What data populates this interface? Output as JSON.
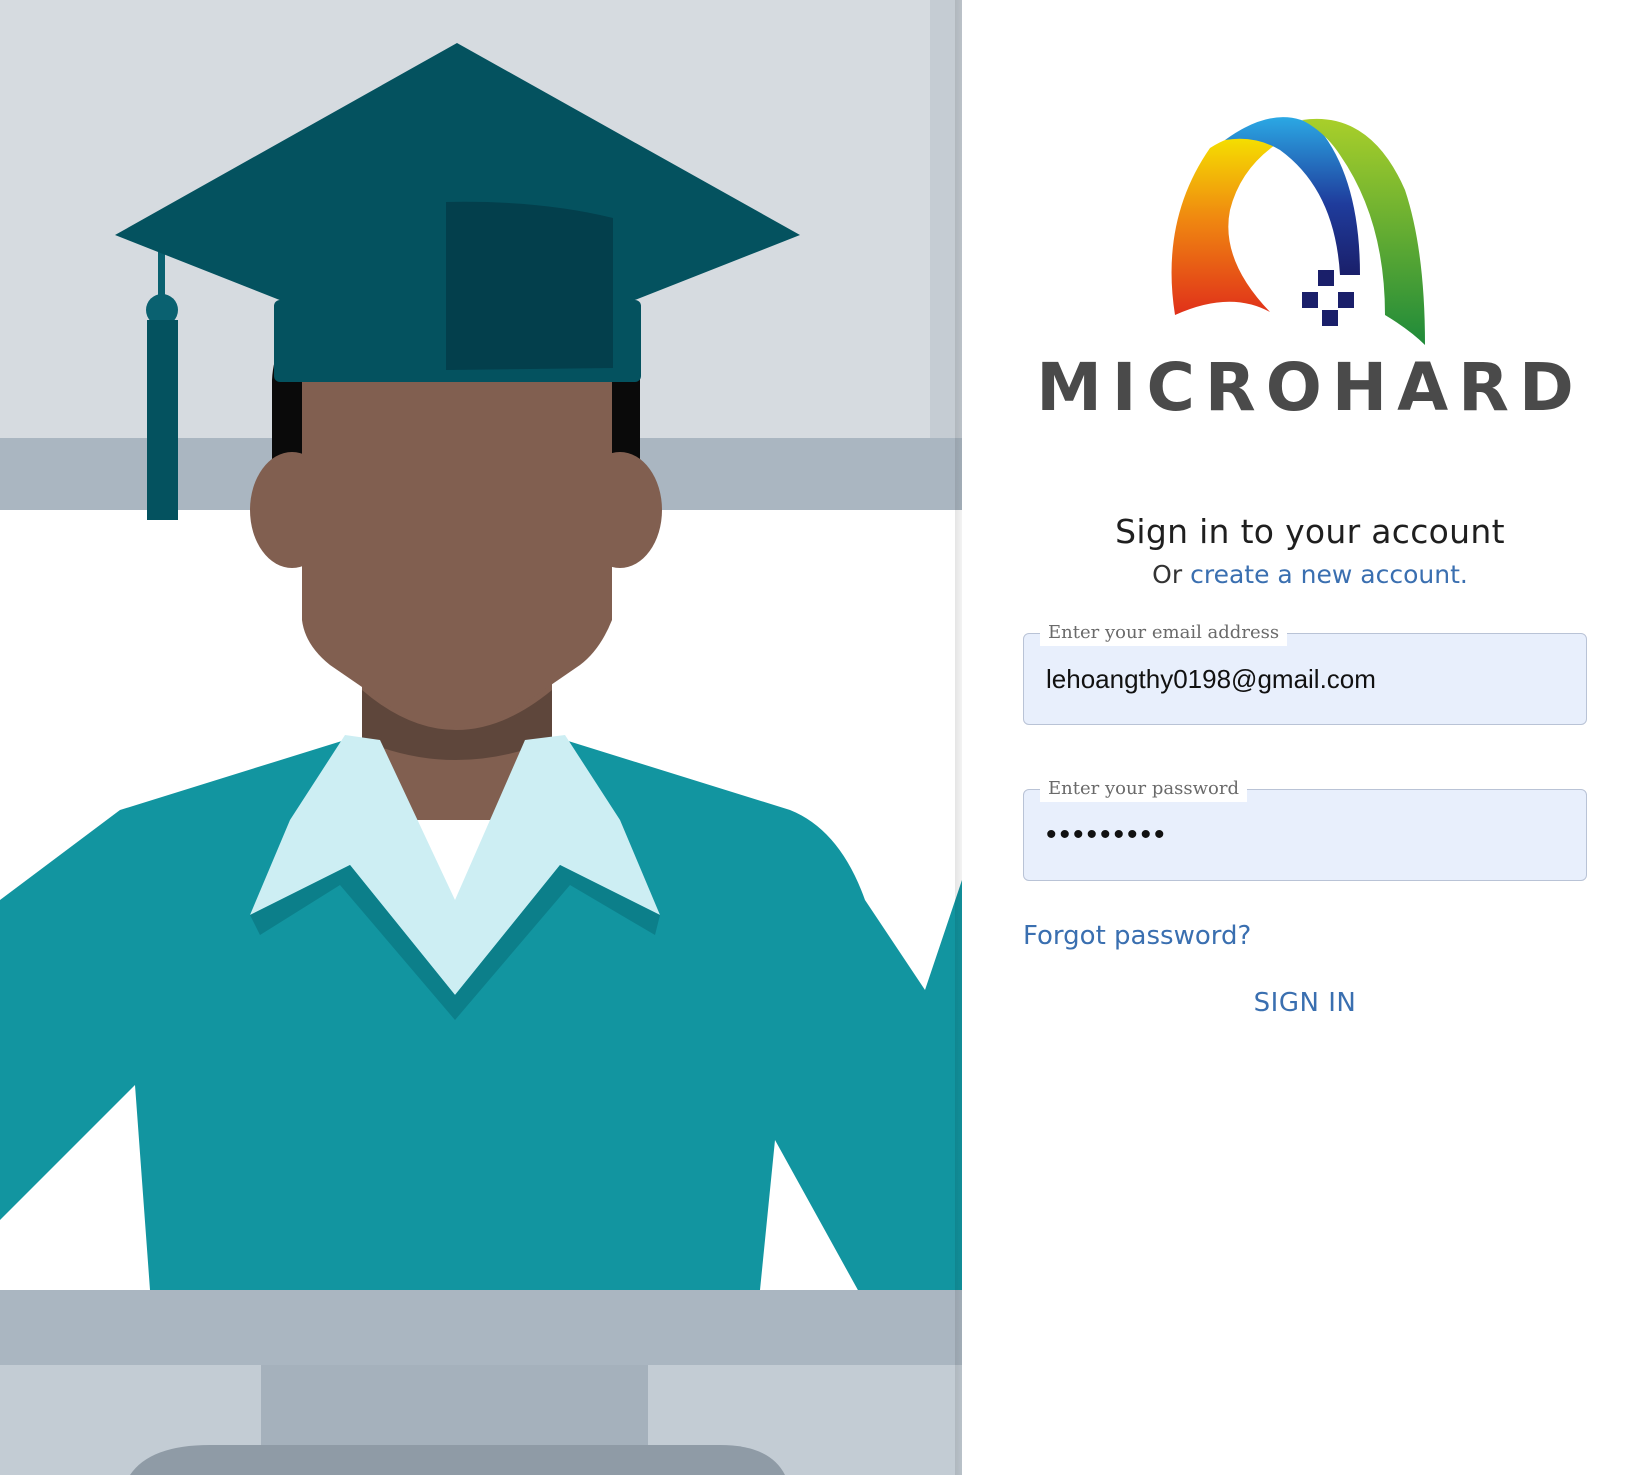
{
  "brand": {
    "logo_text": "MICROHARD"
  },
  "signin": {
    "heading": "Sign in to your account",
    "or_text": "Or",
    "create_link": "create a new account.",
    "email": {
      "label": "Enter your email address",
      "value": "lehoangthy0198@gmail.com"
    },
    "password": {
      "label": "Enter your password",
      "value": "•••••••••"
    },
    "forgot_link": "Forgot password?",
    "submit_label": "SIGN IN"
  },
  "colors": {
    "link": "#3a6fb0",
    "field_background": "#e8effc",
    "cap": "#04525f",
    "sweater": "#1295a0",
    "skin": "#815f50",
    "collar": "#cdeef3"
  }
}
